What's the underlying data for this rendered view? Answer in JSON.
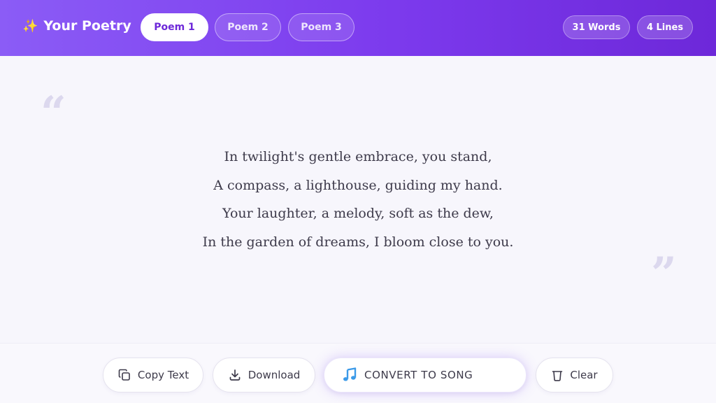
{
  "header": {
    "brand_icon": "sparkles-icon",
    "brand_emoji": "✨",
    "title": "Your Poetry",
    "tabs": [
      {
        "label": "Poem 1",
        "active": true
      },
      {
        "label": "Poem 2",
        "active": false
      },
      {
        "label": "Poem 3",
        "active": false
      }
    ],
    "stats": {
      "words": "31 Words",
      "lines": "4 Lines"
    }
  },
  "poem": {
    "open_quote": "“",
    "close_quote": "”",
    "lines": [
      "In twilight's gentle embrace, you stand,",
      "A compass, a lighthouse, guiding my hand.",
      "Your laughter, a melody, soft as the dew,",
      "In the garden of dreams, I bloom close to you."
    ]
  },
  "actions": {
    "copy": {
      "label": "Copy Text",
      "icon": "copy-icon"
    },
    "download": {
      "label": "Download",
      "icon": "download-icon"
    },
    "convert": {
      "label": "CONVERT TO SONG",
      "icon": "music-note-icon"
    },
    "clear": {
      "label": "Clear",
      "icon": "trash-icon"
    }
  },
  "colors": {
    "header_start": "#8b5cf6",
    "header_end": "#6d28d9",
    "accent": "#7c3aed",
    "music_icon": "#3b9ae8"
  }
}
